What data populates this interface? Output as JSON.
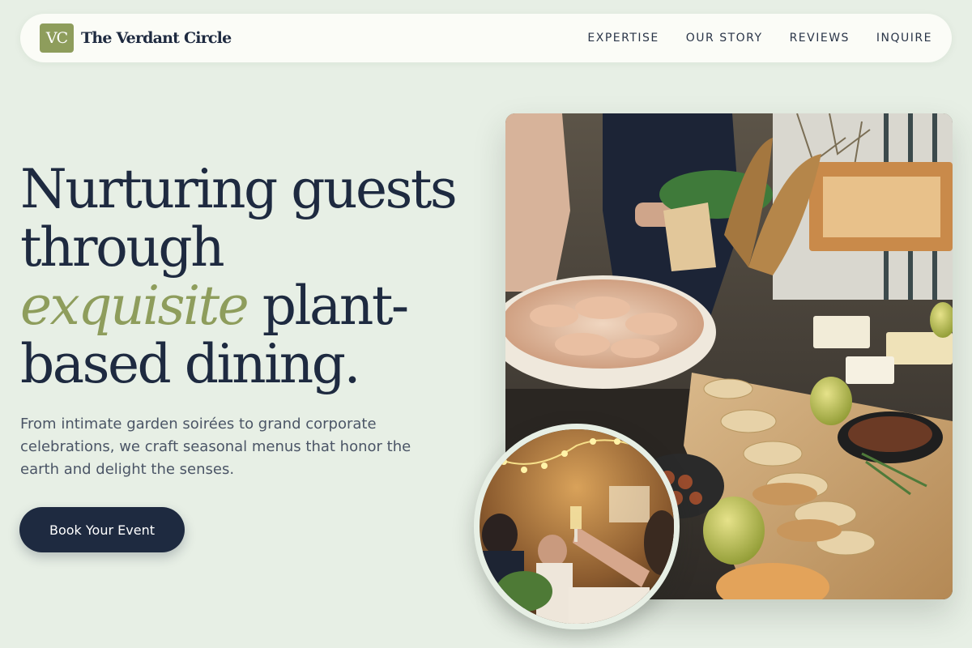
{
  "brand": {
    "logo_initials": "VC",
    "name": "The Verdant Circle"
  },
  "nav": {
    "items": [
      {
        "label": "EXPERTISE"
      },
      {
        "label": "OUR STORY"
      },
      {
        "label": "REVIEWS"
      },
      {
        "label": "INQUIRE"
      }
    ]
  },
  "hero": {
    "title_line1": "Nurturing guests",
    "title_line2": "through",
    "title_accent": "exquisite",
    "title_line3_rest": " plant-",
    "title_line4": "based dining.",
    "subtitle": "From intimate garden soirées to grand corporate celebrations, we craft seasonal menus that honor the earth and delight the senses.",
    "cta_label": "Book Your Event"
  },
  "images": {
    "main": {
      "subject": "catering-buffet-table"
    },
    "circle": {
      "subject": "guests-toasting-champagne"
    }
  },
  "colors": {
    "background": "#e7efe5",
    "navy": "#1e2a40",
    "accent_green": "#8e9d5c",
    "header_bg": "#fbfcf7"
  }
}
